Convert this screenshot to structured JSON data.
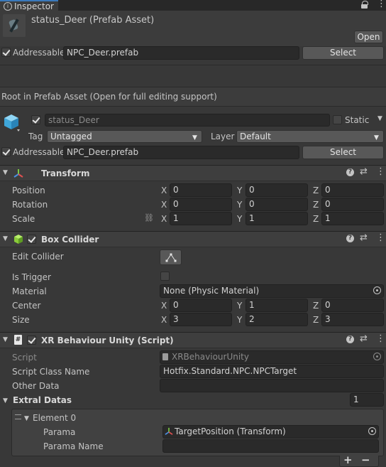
{
  "tab": {
    "label": "Inspector"
  },
  "asset": {
    "title": "status_Deer (Prefab Asset)",
    "open_label": "Open"
  },
  "addressable_top": {
    "label": "Addressable",
    "value": "NPC_Deer.prefab",
    "select_label": "Select"
  },
  "root_note": "Root in Prefab Asset (Open for full editing support)",
  "gameobject": {
    "name": "status_Deer",
    "static_label": "Static",
    "tag_label": "Tag",
    "tag_value": "Untagged",
    "layer_label": "Layer",
    "layer_value": "Default",
    "addressable_label": "Addressable",
    "addressable_value": "NPC_Deer.prefab",
    "select_label": "Select"
  },
  "transform": {
    "title": "Transform",
    "rows": [
      {
        "label": "Position",
        "x": "0",
        "y": "0",
        "z": "0"
      },
      {
        "label": "Rotation",
        "x": "0",
        "y": "0",
        "z": "0"
      },
      {
        "label": "Scale",
        "x": "1",
        "y": "1",
        "z": "1"
      }
    ],
    "axis": {
      "x": "X",
      "y": "Y",
      "z": "Z"
    }
  },
  "box_collider": {
    "title": "Box Collider",
    "edit_label": "Edit Collider",
    "trigger_label": "Is Trigger",
    "material_label": "Material",
    "material_value": "None (Physic Material)",
    "center_label": "Center",
    "center": {
      "x": "0",
      "y": "1",
      "z": "0"
    },
    "size_label": "Size",
    "size": {
      "x": "3",
      "y": "2",
      "z": "3"
    }
  },
  "script": {
    "title": "XR Behaviour Unity (Script)",
    "script_label": "Script",
    "script_value": "XRBehaviourUnity",
    "class_label": "Script Class Name",
    "class_value": "Hotfix.Standard.NPC.NPCTarget",
    "other_label": "Other Data",
    "other_value": "",
    "extral_label": "Extral Datas",
    "extral_count": "1",
    "element_label": "Element 0",
    "parama_label": "Parama",
    "parama_value": "TargetPosition (Transform)",
    "parama_name_label": "Parama Name",
    "parama_name_value": "",
    "add_label": "+",
    "remove_label": "−"
  },
  "colors": {
    "background": "#383838",
    "field": "#2a2a2a",
    "header": "#3e3e3e",
    "tab": "#3c3c3c"
  }
}
